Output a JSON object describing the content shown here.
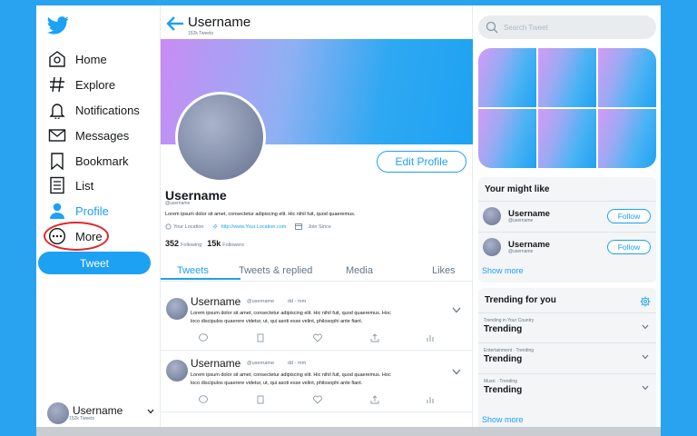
{
  "colors": {
    "brand": "#1da1f2",
    "background": "#29a3f0",
    "highlight_circle": "#e0262c"
  },
  "sidebar": {
    "items": [
      {
        "label": "Home",
        "icon": "home-icon"
      },
      {
        "label": "Explore",
        "icon": "hashtag-icon"
      },
      {
        "label": "Notifications",
        "icon": "bell-icon"
      },
      {
        "label": "Messages",
        "icon": "envelope-icon"
      },
      {
        "label": "Bookmark",
        "icon": "bookmark-icon"
      },
      {
        "label": "List",
        "icon": "list-icon"
      },
      {
        "label": "Profile",
        "icon": "person-icon"
      },
      {
        "label": "More",
        "icon": "more-icon"
      }
    ],
    "tweet_label": "Tweet",
    "account": {
      "name": "Username",
      "sub": "152k Tweets"
    }
  },
  "header": {
    "title": "Username",
    "subtitle": "152k Tweets"
  },
  "profile": {
    "edit_label": "Edit Profile",
    "name": "Username",
    "handle": "@username",
    "bio": "Lorem ipsum dolor sit amet, consectetur adipiscing elit. Hic nihil fuit, quod quaeremus.",
    "location": "Your Location",
    "link": "http://www.Your.Location.com",
    "joined": "Join Since",
    "following_count": "352",
    "following_label": "Following",
    "followers_count": "15k",
    "followers_label": "Followers"
  },
  "tabs": [
    "Tweets",
    "Tweets & replied",
    "Media",
    "Likes"
  ],
  "tweets": [
    {
      "name": "Username",
      "handle": "@username",
      "date": "dd - mm",
      "text1": "Lorem ipsum dolor sit amet, consectetur adipiscing elit. Hic nihil fuit, quod quaeremus. Hoc",
      "text2": "loco discipulos quaerere videtur, ut, qui asoti esse velint, philosophi ante fiant."
    },
    {
      "name": "Username",
      "handle": "@username",
      "date": "dd - mm",
      "text1": "Lorem ipsum dolor sit amet, consectetur adipiscing elit. Hic nihil fuit, quod quaeremus. Hoc",
      "text2": "loco discipulos quaerere videtur, ut, qui asoti esse velint, philosophi ante fiant."
    }
  ],
  "right": {
    "search_placeholder": "Search Tweet",
    "might_like": {
      "title": "Your might like",
      "users": [
        {
          "name": "Username",
          "handle": "@username",
          "button": "Follow"
        },
        {
          "name": "Username",
          "handle": "@username",
          "button": "Follow"
        }
      ],
      "show_more": "Show more"
    },
    "trending": {
      "title": "Trending for you",
      "items": [
        {
          "context": "Trending in Your Country",
          "title": "Trending"
        },
        {
          "context": "Entertainment · Trending",
          "title": "Trending"
        },
        {
          "context": "Music · Trending",
          "title": "Trending"
        }
      ],
      "show_more": "Show more"
    }
  }
}
